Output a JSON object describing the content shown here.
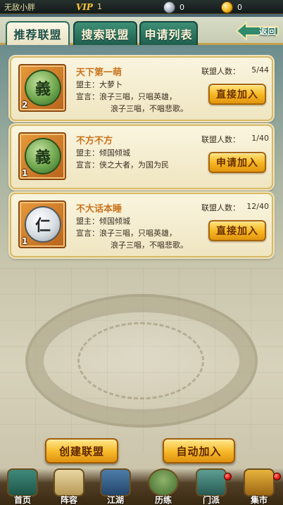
{
  "topbar": {
    "player_name": "无敌小胖",
    "vip_label": "VIP",
    "vip_level": "1",
    "silver": "0",
    "gold": "0"
  },
  "tabs": [
    {
      "label": "推荐联盟",
      "active": true
    },
    {
      "label": "搜索联盟",
      "active": false
    },
    {
      "label": "申请列表",
      "active": false
    }
  ],
  "back_label": "返回",
  "alliances": [
    {
      "name": "天下第一萌",
      "level": "2",
      "emblem_char": "義",
      "emblem_icon": "jade-yi-emblem-icon",
      "leader_key": "盟主：",
      "leader": "大萝卜",
      "decl_key": "宣言：",
      "decl_line1": "浪子三唱，只唱英雄，",
      "decl_line2": "浪子三唱，不唱悲歌。",
      "members_key": "联盟人数：",
      "members": "5/44",
      "action": "直接加入"
    },
    {
      "name": "不方不方",
      "level": "1",
      "emblem_char": "義",
      "emblem_icon": "jade-yi-emblem-icon",
      "leader_key": "盟主：",
      "leader": "倾国倾城",
      "decl_key": "宣言：",
      "decl_line1": "侠之大者，为国为民",
      "decl_line2": "",
      "members_key": "联盟人数：",
      "members": "1/40",
      "action": "申请加入"
    },
    {
      "name": "不大话本睡",
      "level": "1",
      "emblem_char": "仁",
      "emblem_icon": "stone-ren-emblem-icon",
      "leader_key": "盟主：",
      "leader": "倾国倾城",
      "decl_key": "宣言：",
      "decl_line1": "浪子三唱，只唱英雄，",
      "decl_line2": "浪子三唱，不唱悲歌。",
      "members_key": "联盟人数：",
      "members": "12/40",
      "action": "直接加入"
    }
  ],
  "buttons": {
    "create": "创建联盟",
    "auto_join": "自动加入"
  },
  "nav": [
    {
      "label": "首页",
      "icon": "home-icon"
    },
    {
      "label": "阵容",
      "icon": "scroll-icon"
    },
    {
      "label": "江湖",
      "icon": "sword-icon"
    },
    {
      "label": "历练",
      "icon": "gourd-icon"
    },
    {
      "label": "门派",
      "icon": "pavilion-icon"
    },
    {
      "label": "集市",
      "icon": "treasure-icon"
    }
  ],
  "colors": {
    "tab_active_border": "#2c6e5e",
    "tab_inactive_bg": "#1f5f4d",
    "button_gold": "#f5b51f",
    "alliance_name": "#c9731c",
    "notify_red": "#e0140c"
  }
}
